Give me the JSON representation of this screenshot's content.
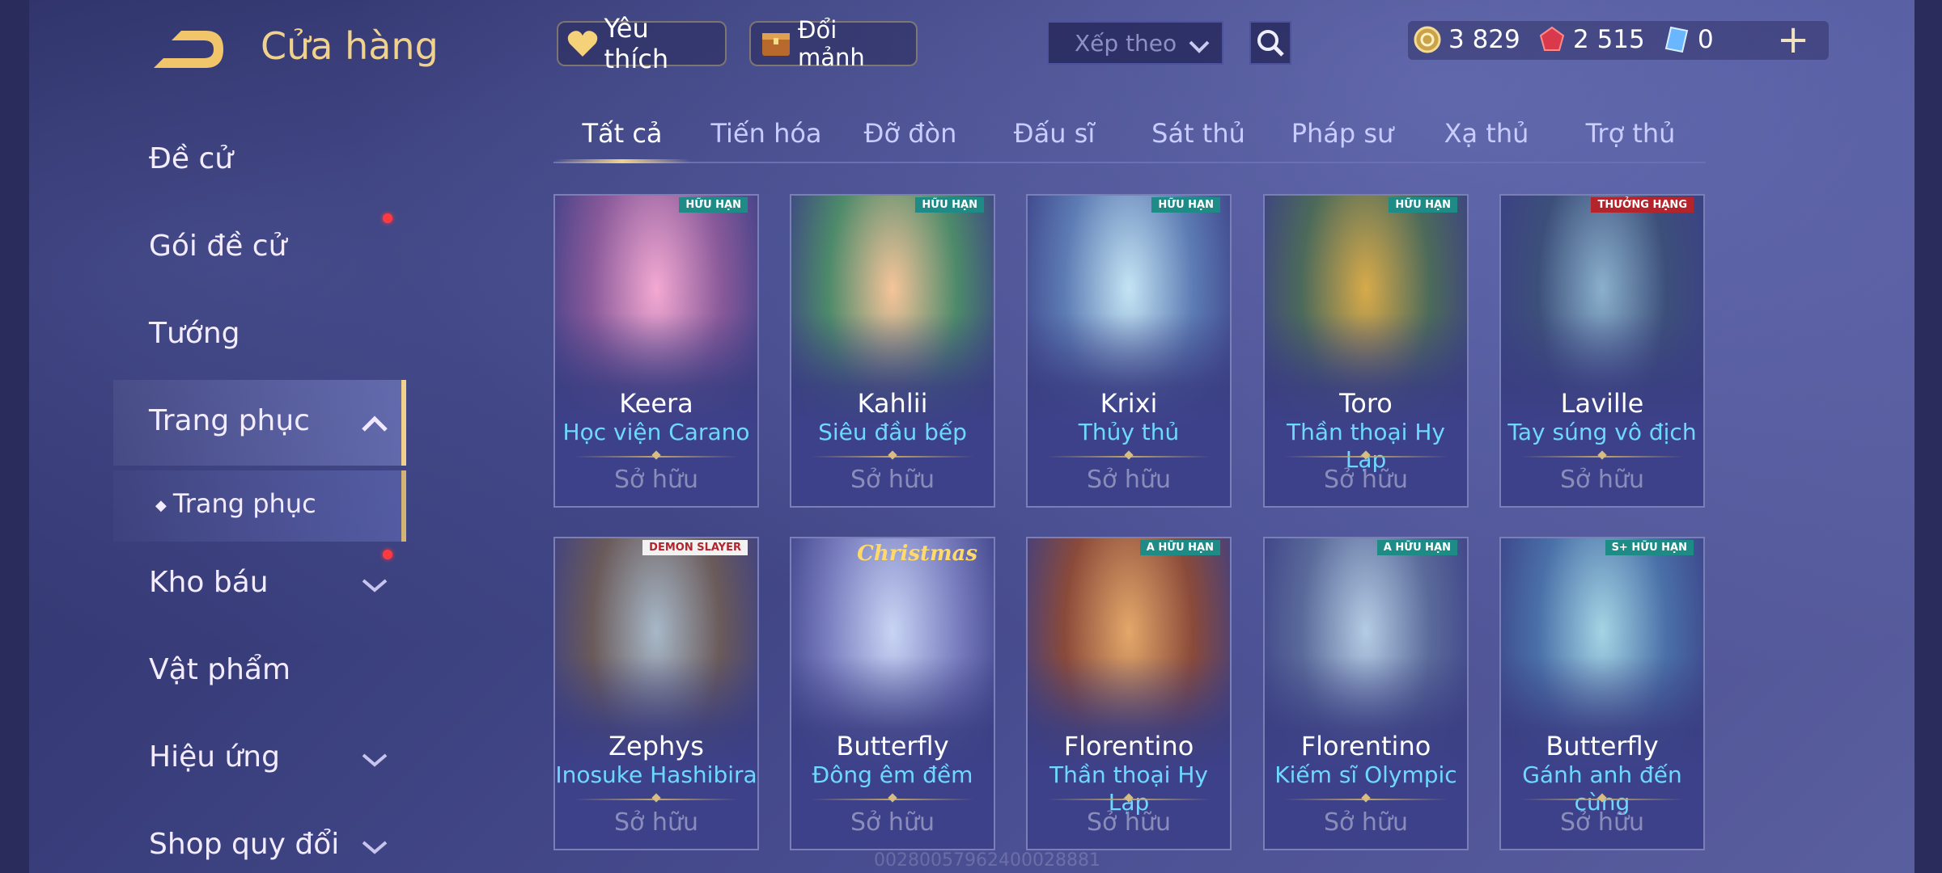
{
  "header": {
    "title": "Cửa hàng",
    "favorite_label": "Yêu thích",
    "exchange_label": "Đổi mảnh",
    "sort_placeholder": "Xếp theo",
    "currencies": [
      {
        "icon": "gold-coin-icon",
        "value": "3 829"
      },
      {
        "icon": "red-gem-icon",
        "value": "2 515"
      },
      {
        "icon": "blue-card-icon",
        "value": "0"
      }
    ],
    "plus": "+"
  },
  "sidebar": {
    "items": [
      {
        "label": "Đề cử"
      },
      {
        "label": "Gói đề cử"
      },
      {
        "label": "Tướng"
      },
      {
        "label": "Trang phục"
      },
      {
        "label": "Trang phục"
      },
      {
        "label": "Kho báu"
      },
      {
        "label": "Vật phẩm"
      },
      {
        "label": "Hiệu ứng"
      },
      {
        "label": "Shop quy đổi"
      }
    ]
  },
  "tabs": [
    "Tất cả",
    "Tiến hóa",
    "Đỡ đòn",
    "Đấu sĩ",
    "Sát thủ",
    "Pháp sư",
    "Xạ thủ",
    "Trợ thủ"
  ],
  "cards": [
    {
      "hero": "Keera",
      "skin": "Học viện Carano",
      "status": "Sở hữu",
      "badge": "HỮU HẠN",
      "colors": [
        "#f3a9d2",
        "#8a5a9a",
        "#3b3f86"
      ]
    },
    {
      "hero": "Kahlii",
      "skin": "Siêu đầu bếp",
      "status": "Sở hữu",
      "badge": "HỮU HẠN",
      "colors": [
        "#f6c49a",
        "#4d8a6a",
        "#3b3f86"
      ]
    },
    {
      "hero": "Krixi",
      "skin": "Thủy thủ",
      "status": "Sở hữu",
      "badge": "HỮU HẠN",
      "colors": [
        "#c4e4f4",
        "#5d7cb4",
        "#3b3f86"
      ]
    },
    {
      "hero": "Toro",
      "skin": "Thần thoại Hy Lạp",
      "status": "Sở hữu",
      "badge": "HỮU HẠN",
      "colors": [
        "#d8aa4a",
        "#4c6a5a",
        "#3b3f86"
      ]
    },
    {
      "hero": "Laville",
      "skin": "Tay súng vô địch",
      "status": "Sở hữu",
      "badge": "THƯỞNG HẠNG",
      "colors": [
        "#8ab0cc",
        "#3c4f7a",
        "#3b3f86"
      ]
    },
    {
      "hero": "Zephys",
      "skin": "Inosuke Hashibira",
      "status": "Sở hữu",
      "badge": "DEMON SLAYER",
      "colors": [
        "#a7b8c8",
        "#6a5a5a",
        "#3b3f86"
      ]
    },
    {
      "hero": "Butterfly",
      "skin": "Đông êm đềm",
      "status": "Sở hữu",
      "badge": "Christmas",
      "colors": [
        "#c8d4f4",
        "#7a7fc0",
        "#3b3f86"
      ]
    },
    {
      "hero": "Florentino",
      "skin": "Thần thoại Hy Lạp",
      "status": "Sở hữu",
      "badge": "A HỮU HẠN",
      "colors": [
        "#e3a86a",
        "#8a4a3a",
        "#3b3f86"
      ]
    },
    {
      "hero": "Florentino",
      "skin": "Kiếm sĩ Olympic",
      "status": "Sở hữu",
      "badge": "A HỮU HẠN",
      "colors": [
        "#b4cce4",
        "#5a6a9a",
        "#3b3f86"
      ]
    },
    {
      "hero": "Butterfly",
      "skin": "Gánh anh đến cùng",
      "status": "Sở hữu",
      "badge": "S+ HỮU HẠN",
      "colors": [
        "#a4d4e4",
        "#4a70a8",
        "#3b3f86"
      ]
    }
  ],
  "watermark": "00280057962400028881"
}
